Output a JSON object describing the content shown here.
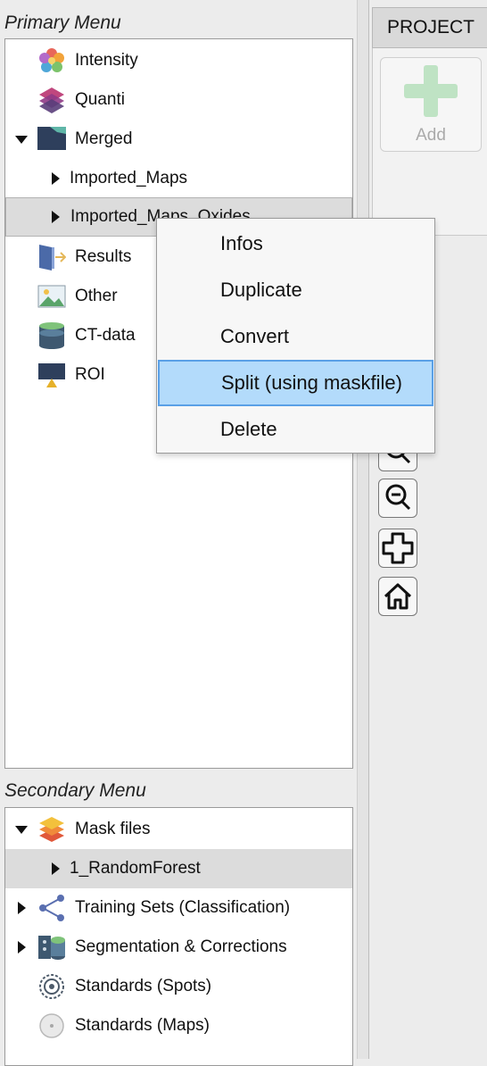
{
  "primary_menu": {
    "title": "Primary Menu",
    "items": [
      {
        "label": "Intensity",
        "icon": "intensity-flower-icon"
      },
      {
        "label": "Quanti",
        "icon": "quanti-layers-icon"
      },
      {
        "label": "Merged",
        "icon": "merged-map-icon",
        "expanded": true
      },
      {
        "label": "Imported_Maps",
        "child": true
      },
      {
        "label": "Imported_Maps_Oxides",
        "child": true,
        "selected": true
      },
      {
        "label": "Results",
        "icon": "results-door-icon"
      },
      {
        "label": "Other",
        "icon": "other-image-icon"
      },
      {
        "label": "CT-data",
        "icon": "ct-data-cylinder-icon"
      },
      {
        "label": "ROI",
        "icon": "roi-icon"
      }
    ]
  },
  "secondary_menu": {
    "title": "Secondary Menu",
    "items": [
      {
        "label": "Mask files",
        "icon": "mask-layers-icon",
        "expanded": true
      },
      {
        "label": "1_RandomForest",
        "child": true,
        "selected": true
      },
      {
        "label": "Training Sets (Classification)",
        "icon": "training-network-icon"
      },
      {
        "label": "Segmentation & Corrections",
        "icon": "segmentation-icon"
      },
      {
        "label": "Standards (Spots)",
        "icon": "standards-spots-icon"
      },
      {
        "label": "Standards (Maps)",
        "icon": "standards-maps-icon"
      }
    ]
  },
  "context_menu": {
    "items": [
      "Infos",
      "Duplicate",
      "Convert",
      "Split (using maskfile)",
      "Delete"
    ],
    "highlighted": "Split (using maskfile)"
  },
  "project_panel": {
    "tab_label": "PROJECT",
    "add_label": "Add"
  },
  "toolbar": {
    "tools": [
      "zoom-in-icon",
      "zoom-out-icon",
      "pan-icon",
      "home-icon"
    ]
  },
  "colors": {
    "selection": "#dcdcdc",
    "menu_highlight": "#b3dbfb",
    "menu_highlight_border": "#5aa0e6",
    "add_plus": "#bfe3c4"
  }
}
